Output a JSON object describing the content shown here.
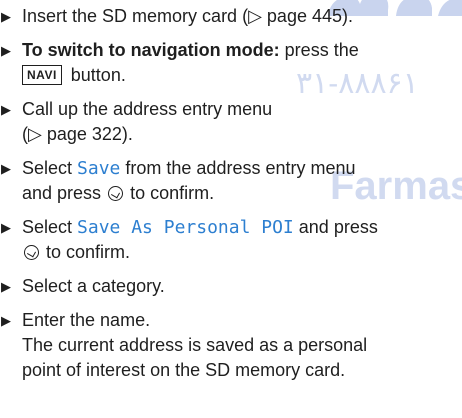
{
  "steps": [
    {
      "pre": "Insert the SD memory card (",
      "ref_arrow": "▷",
      "ref": " page 445",
      "post": ")."
    },
    {
      "bold": "To switch to navigation mode:",
      "pre": " press the",
      "key": "NAVI",
      "post": " button."
    },
    {
      "pre": "Call up the address entry menu",
      "line2_open": "(",
      "ref_arrow": "▷",
      "ref": " page 322",
      "post": ")."
    },
    {
      "pre": "Select ",
      "ui": "Save",
      "mid": " from the address entry menu",
      "line2": "and press ",
      "post": " to confirm."
    },
    {
      "pre": "Select ",
      "ui": "Save As Personal POI",
      "mid": " and press",
      "post": " to confirm."
    },
    {
      "text": "Select a category."
    },
    {
      "text": "Enter the name.",
      "result_line1": "The current address is saved as a personal",
      "result_line2": "point of interest on the SD memory card."
    }
  ],
  "bullet_glyph": "▶",
  "control_icon": "controller-press-icon",
  "watermark": {
    "digits": "۳۱-۸۸۸۶۱",
    "word": "Farmas"
  }
}
